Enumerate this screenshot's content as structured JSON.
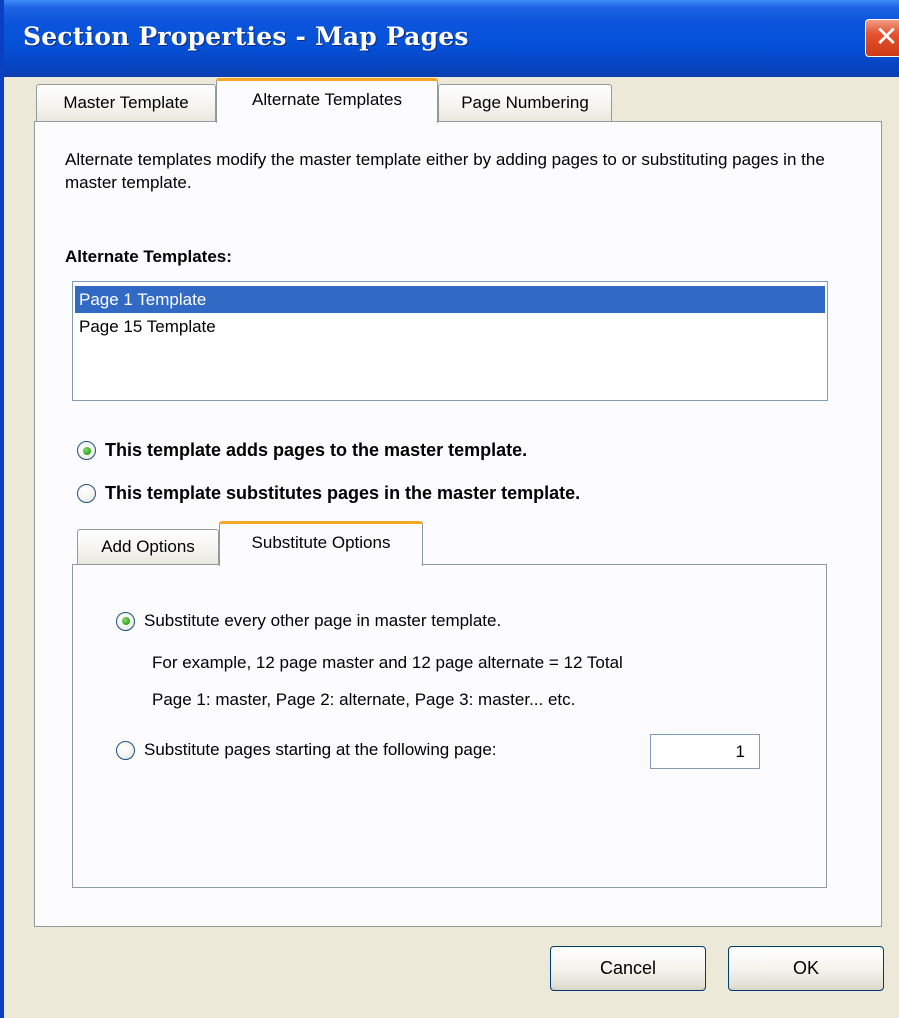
{
  "window": {
    "title": "Section Properties - Map Pages",
    "close_glyph": "✕"
  },
  "main_tabs": [
    {
      "label": "Master Template",
      "active": false
    },
    {
      "label": "Alternate Templates",
      "active": true
    },
    {
      "label": "Page Numbering",
      "active": false
    }
  ],
  "alternate_templates": {
    "description": "Alternate templates modify the master template either by adding pages to or substituting pages in the master template.",
    "list_label": "Alternate Templates:",
    "list_items": [
      {
        "label": "Page 1 Template",
        "selected": true
      },
      {
        "label": "Page 15 Template",
        "selected": false
      }
    ],
    "mode_options": [
      {
        "label": "This template adds pages to the master template.",
        "checked": true
      },
      {
        "label": "This template substitutes pages in the master template.",
        "checked": false
      }
    ]
  },
  "sub_tabs": [
    {
      "label": "Add Options",
      "active": false
    },
    {
      "label": "Substitute Options",
      "active": true
    }
  ],
  "substitute_options": {
    "every_other": {
      "label": "Substitute every other page in master template.",
      "checked": true
    },
    "example_line": "For example, 12 page master and 12 page alternate = 12 Total",
    "pattern_line": "Page 1: master, Page 2: alternate, Page 3: master... etc.",
    "starting_at": {
      "label": "Substitute pages starting at the following page:",
      "checked": false
    },
    "start_page_value": "1"
  },
  "buttons": {
    "cancel": "Cancel",
    "ok": "OK"
  },
  "colors": {
    "title_bar": "#0550d8",
    "active_tab_accent": "#f5a623",
    "selection": "#316ac5",
    "radio_checked": "#2fa51a",
    "dialog_face": "#ece9d8"
  },
  "icons": {
    "close": "close-icon"
  }
}
